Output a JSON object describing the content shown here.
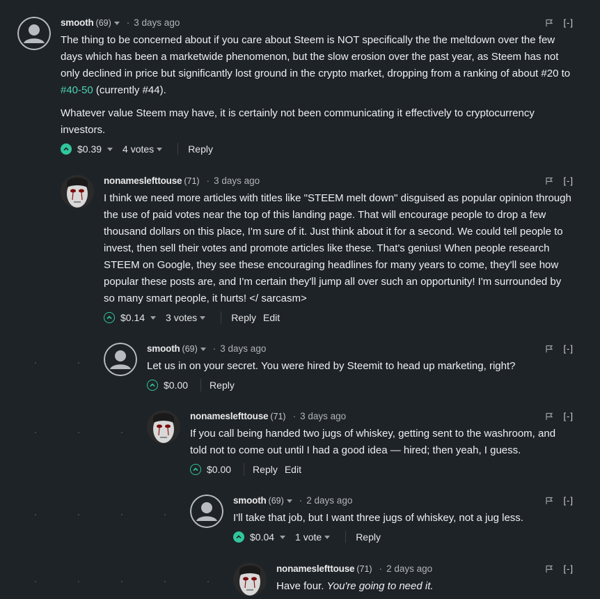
{
  "comments": [
    {
      "author": "smooth",
      "rep": "(69)",
      "time": "3 days ago",
      "collapse": "[-]",
      "avatar": "default-avatar-icon",
      "paragraphs": [
        {
          "before": "The thing to be concerned about if you care about Steem is NOT specifically the the meltdown over the few days which has been a marketwide phenomenon, but the slow erosion over the past year, as Steem has not only declined in price but significantly lost ground in the crypto market, dropping from a ranking of about #20 to ",
          "link": "#40-50",
          "after": " (currently #44)."
        },
        {
          "before": "Whatever value Steem may have, it is certainly not been communicating it effectively to cryptocurrency investors."
        }
      ],
      "payout": "$0.39",
      "votes": "4 votes",
      "voted": true,
      "reply": "Reply"
    },
    {
      "author": "nonameslefttouse",
      "rep": "(71)",
      "time": "3 days ago",
      "collapse": "[-]",
      "avatar": "mask-avatar-icon",
      "paragraphs": [
        {
          "before": "I think we need more articles with titles like \"STEEM melt down\" disguised as popular opinion through the use of paid votes near the top of this landing page. That will encourage people to drop a few thousand dollars on this place, I'm sure of it. Just think about it for a second. We could tell people to invest, then sell their votes and promote articles like these. That's genius! When people research STEEM on Google, they see these encouraging headlines for many years to come, they'll see how popular these posts are, and I'm certain they'll jump all over such an opportunity! I'm surrounded by so many smart people, it hurts! </ sarcasm>"
        }
      ],
      "payout": "$0.14",
      "votes": "3 votes",
      "voted": false,
      "reply": "Reply",
      "edit": "Edit"
    },
    {
      "author": "smooth",
      "rep": "(69)",
      "time": "3 days ago",
      "collapse": "[-]",
      "avatar": "default-avatar-icon",
      "paragraphs": [
        {
          "before": "Let us in on your secret. You were hired by Steemit to head up marketing, right?"
        }
      ],
      "payout": "$0.00",
      "voted": false,
      "reply": "Reply"
    },
    {
      "author": "nonameslefttouse",
      "rep": "(71)",
      "time": "3 days ago",
      "collapse": "[-]",
      "avatar": "mask-avatar-icon",
      "paragraphs": [
        {
          "before": "If you call being handed two jugs of whiskey, getting sent to the washroom, and told not to come out until I had a good idea — hired; then yeah, I guess."
        }
      ],
      "payout": "$0.00",
      "voted": false,
      "reply": "Reply",
      "edit": "Edit"
    },
    {
      "author": "smooth",
      "rep": "(69)",
      "time": "2 days ago",
      "collapse": "[-]",
      "avatar": "default-avatar-icon",
      "paragraphs": [
        {
          "before": "I'll take that job, but I want three jugs of whiskey, not a jug less."
        }
      ],
      "payout": "$0.04",
      "votes": "1 vote",
      "voted": true,
      "reply": "Reply"
    },
    {
      "author": "nonameslefttouse",
      "rep": "(71)",
      "time": "2 days ago",
      "collapse": "[-]",
      "avatar": "mask-avatar-icon",
      "paragraphs": [
        {
          "before": "Have four. ",
          "em": "You're going to need it."
        }
      ]
    }
  ],
  "colors": {
    "background": "#1e2328",
    "accent": "#30c79d",
    "link": "#4fd1b2",
    "text": "#eef0f2"
  }
}
